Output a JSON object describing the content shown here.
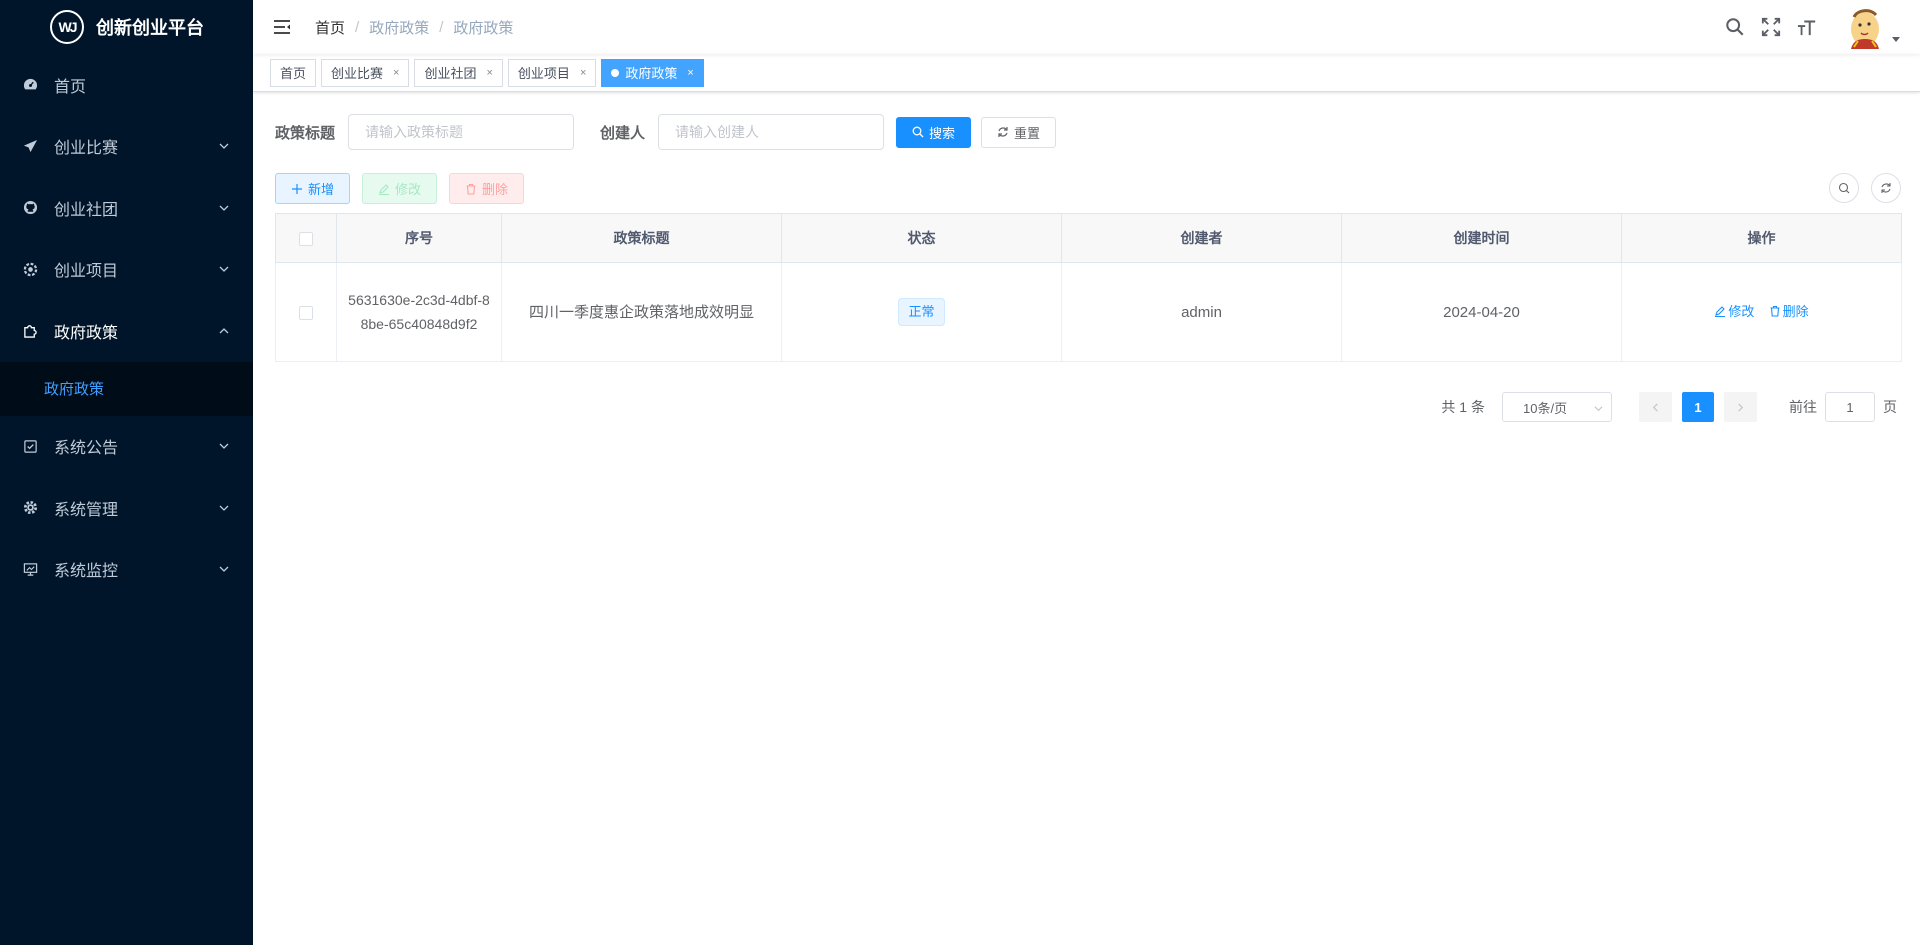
{
  "app": {
    "title": "创新创业平台",
    "logo_text": "WJ"
  },
  "sidebar": {
    "items": [
      {
        "label": "首页",
        "icon": "dashboard-icon"
      },
      {
        "label": "创业比赛",
        "icon": "send-icon"
      },
      {
        "label": "创业社团",
        "icon": "github-icon"
      },
      {
        "label": "创业项目",
        "icon": "gear-outline-icon"
      },
      {
        "label": "政府政策",
        "icon": "puzzle-icon"
      },
      {
        "label": "系统公告",
        "icon": "checkbox-icon"
      },
      {
        "label": "系统管理",
        "icon": "gear-icon"
      },
      {
        "label": "系统监控",
        "icon": "monitor-icon"
      }
    ],
    "active_submenu": {
      "label": "政府政策"
    }
  },
  "breadcrumb": [
    "首页",
    "政府政策",
    "政府政策"
  ],
  "tags": [
    {
      "label": "首页"
    },
    {
      "label": "创业比赛"
    },
    {
      "label": "创业社团"
    },
    {
      "label": "创业项目"
    },
    {
      "label": "政府政策"
    }
  ],
  "search": {
    "title_label": "政策标题",
    "title_placeholder": "请输入政策标题",
    "creator_label": "创建人",
    "creator_placeholder": "请输入创建人",
    "search_button": "搜索",
    "reset_button": "重置"
  },
  "toolbar": {
    "add": "新增",
    "edit": "修改",
    "delete": "删除"
  },
  "table": {
    "columns": [
      "序号",
      "政策标题",
      "状态",
      "创建者",
      "创建时间",
      "操作"
    ],
    "rows": [
      {
        "id": "5631630e-2c3d-4dbf-88be-65c40848d9f2",
        "title": "四川一季度惠企政策落地成效明显",
        "status": "正常",
        "creator": "admin",
        "created_at": "2024-04-20",
        "edit": "修改",
        "delete": "删除"
      }
    ]
  },
  "pagination": {
    "total_text": "共 1 条",
    "page_size": "10条/页",
    "current_page": "1",
    "goto_label": "前往",
    "goto_value": "1",
    "goto_suffix": "页"
  },
  "colors": {
    "sidebar_bg": "#001529",
    "primary": "#1890ff",
    "active_tag": "#42a4ff"
  }
}
